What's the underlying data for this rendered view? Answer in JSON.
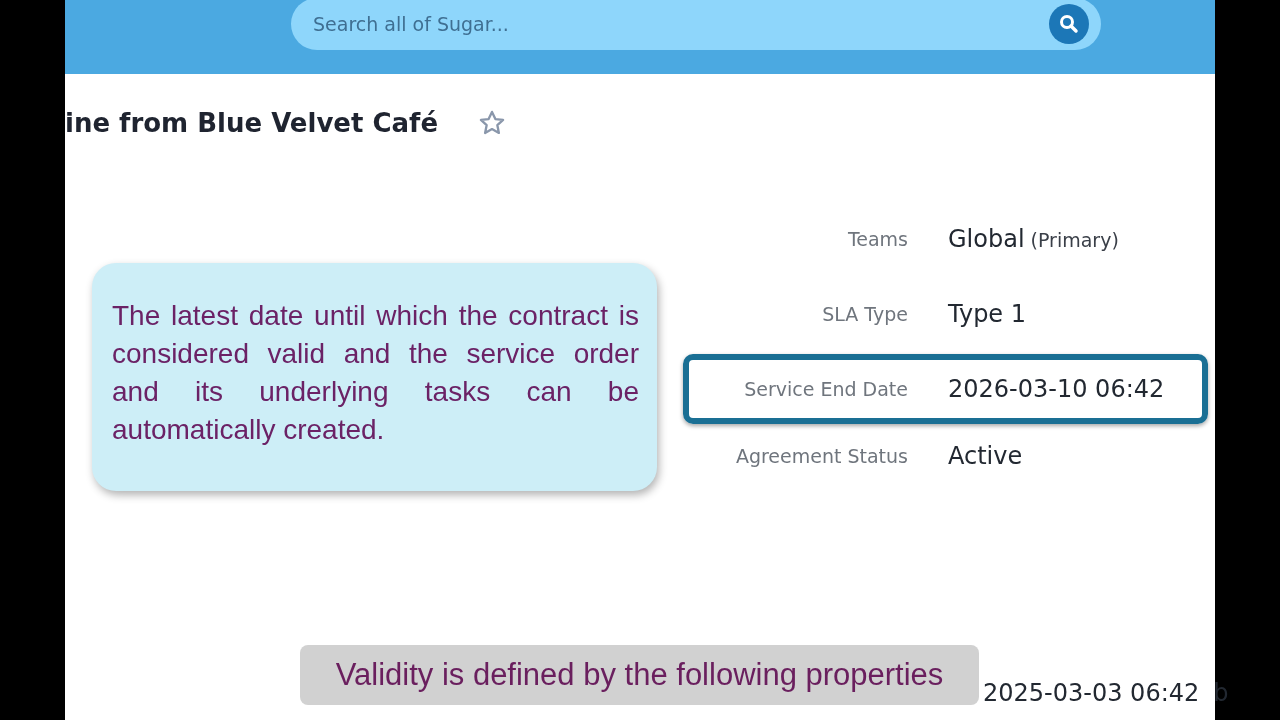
{
  "search": {
    "placeholder": "Search all of Sugar..."
  },
  "record": {
    "title": "ine from Blue Velvet Café",
    "favorite": false
  },
  "fields": [
    {
      "label": "Teams",
      "value": "Global",
      "note": "(Primary)",
      "highlighted": false
    },
    {
      "label": "SLA Type",
      "value": "Type 1",
      "highlighted": false
    },
    {
      "label": "Service End Date",
      "value": "2026-03-10 06:42",
      "highlighted": true
    },
    {
      "label": "Agreement Status",
      "value": "Active",
      "highlighted": false
    }
  ],
  "bottom_row": {
    "value": "2025-03-03 06:42",
    "cut_text": "b"
  },
  "callout": {
    "text": "The latest date until which the contract is considered valid and the service order and its underlying tasks can be automatically created."
  },
  "caption": {
    "text": "Validity is defined by the following properties"
  }
}
